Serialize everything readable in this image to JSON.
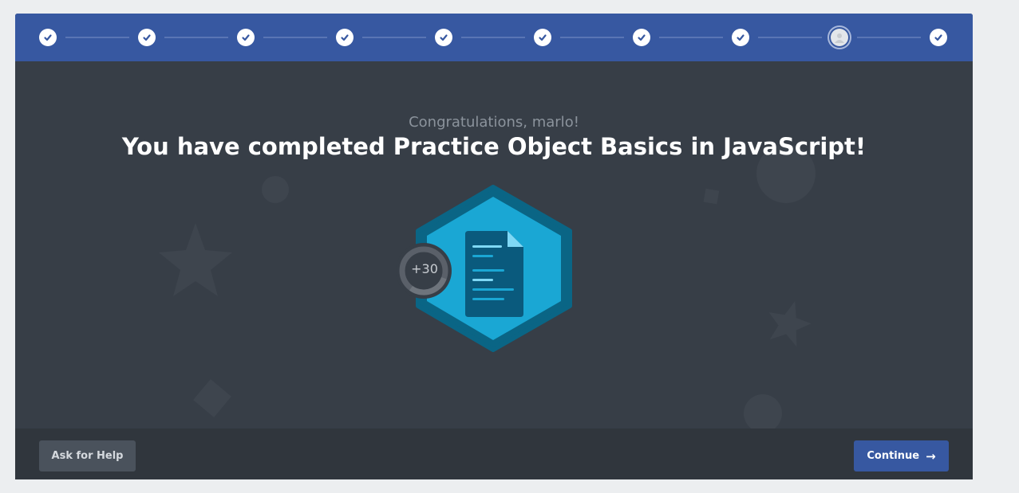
{
  "progress": {
    "steps": [
      {
        "state": "complete",
        "icon": "check-icon"
      },
      {
        "state": "complete",
        "icon": "check-icon"
      },
      {
        "state": "complete",
        "icon": "check-icon"
      },
      {
        "state": "complete",
        "icon": "check-icon"
      },
      {
        "state": "complete",
        "icon": "check-icon"
      },
      {
        "state": "complete",
        "icon": "check-icon"
      },
      {
        "state": "complete",
        "icon": "check-icon"
      },
      {
        "state": "complete",
        "icon": "check-icon"
      },
      {
        "state": "current",
        "icon": "user-icon"
      },
      {
        "state": "complete",
        "icon": "check-icon"
      }
    ]
  },
  "main": {
    "subtitle": "Congratulations, marlo!",
    "title": "You have completed Practice Object Basics in JavaScript!",
    "xp_badge": "+30",
    "badge_icon": "document-icon"
  },
  "footer": {
    "help_label": "Ask for Help",
    "continue_label": "Continue"
  },
  "colors": {
    "header": "#3758a1",
    "background": "#373e47",
    "badge": "#1aa7d4",
    "badge_border": "#0a6585"
  }
}
